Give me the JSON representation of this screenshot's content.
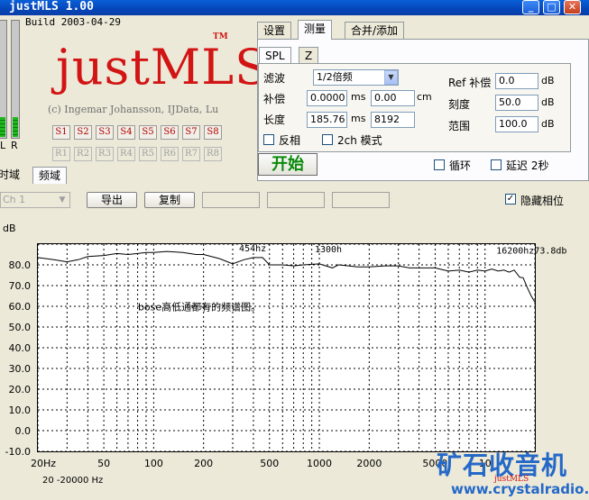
{
  "window": {
    "title": "justMLS 1.00"
  },
  "app": {
    "build": "Build 2003-04-29",
    "logo": "justMLS",
    "trademark": "TM",
    "copyright": "(c) Ingemar Johansson, IJData, Lu",
    "meters": {
      "left_label": "L",
      "right_label": "R"
    },
    "s_buttons": [
      "S1",
      "S2",
      "S3",
      "S4",
      "S5",
      "S6",
      "S7",
      "S8"
    ],
    "r_buttons": [
      "R1",
      "R2",
      "R3",
      "R4",
      "R5",
      "R6",
      "R7",
      "R8"
    ]
  },
  "left_tabs": [
    "时域",
    "频域"
  ],
  "toolbar": {
    "channel": "Ch 1",
    "export_label": "导出",
    "copy_label": "复制",
    "hide_phase_label": "隐藏相位",
    "hide_phase_checked": true,
    "checkmark": "✓"
  },
  "right_tabs": [
    "设置",
    "测量",
    "合并/添加"
  ],
  "sub_tabs": [
    "SPL",
    "Z"
  ],
  "measure": {
    "filter_label": "滤波",
    "filter_value": "1/2倍频",
    "comp_label": "补偿",
    "comp_ms": "0.0000",
    "comp_cm": "0.00",
    "unit_ms": "ms",
    "unit_cm": "cm",
    "length_label": "长度",
    "length_ms": "185.76",
    "length_samples": "8192",
    "invert_label": "反相",
    "twoch_label": "2ch 模式",
    "ref_label": "Ref 补偿",
    "ref_value": "0.0",
    "scale_label": "刻度",
    "scale_value": "50.0",
    "range_label": "范围",
    "range_value": "100.0",
    "unit_db": "dB",
    "start_label": "开始",
    "loop_label": "循环",
    "delay_label": "延迟 2秒"
  },
  "chart_data": {
    "type": "line",
    "ylabel": "dB",
    "y_ticks": [
      "80.0",
      "70.0",
      "60.0",
      "50.0",
      "40.0",
      "30.0",
      "20.0",
      "10.0",
      "0.0",
      "-10.0"
    ],
    "x_ticks": [
      "20Hz",
      "50",
      "100",
      "200",
      "500",
      "1000",
      "2000",
      "5000",
      "10"
    ],
    "ylim": [
      -10,
      90
    ],
    "xlim": [
      20,
      20000
    ],
    "x_scale": "log",
    "grid": true,
    "annotations": [
      {
        "text": "454hz",
        "x": 454,
        "y": 86.5
      },
      {
        "text": "1300h",
        "x": 1300,
        "y": 86
      },
      {
        "text": "16200hz73.8db",
        "x": 16200,
        "y": 85.5
      },
      {
        "text": "bose高低通都有的频谱图。",
        "x": 400,
        "y": 58
      }
    ],
    "series": [
      {
        "x": [
          20,
          25,
          30,
          35,
          40,
          50,
          60,
          70,
          80,
          90,
          100,
          120,
          150,
          180,
          200,
          250,
          300,
          350,
          400,
          454,
          500,
          600,
          700,
          800,
          1000,
          1200,
          1300,
          1500,
          1700,
          2000,
          2500,
          3000,
          3500,
          4000,
          5000,
          6000,
          7000,
          8000,
          9000,
          10000,
          11000,
          12000,
          13000,
          14000,
          15000,
          16200,
          17000,
          18000,
          19000,
          20000
        ],
        "values": [
          83.5,
          82.5,
          81.5,
          82.5,
          84,
          84.5,
          85.5,
          85,
          85.5,
          86,
          86,
          86.5,
          86,
          85,
          85,
          83,
          80.5,
          82.5,
          83.5,
          83.5,
          80,
          80,
          79.5,
          80,
          80.5,
          78.5,
          80,
          79.5,
          79,
          79,
          79.5,
          79.5,
          78.5,
          78.5,
          78.5,
          77,
          77.5,
          76.5,
          77.5,
          77,
          78,
          77,
          77.5,
          76.5,
          77.5,
          74,
          73.8,
          69,
          65,
          62
        ]
      }
    ],
    "range_text": "20   -20000 Hz"
  },
  "watermark": {
    "cn": "矿石收音机",
    "url": "www.crystalradio.cn",
    "small": "justMLS"
  }
}
